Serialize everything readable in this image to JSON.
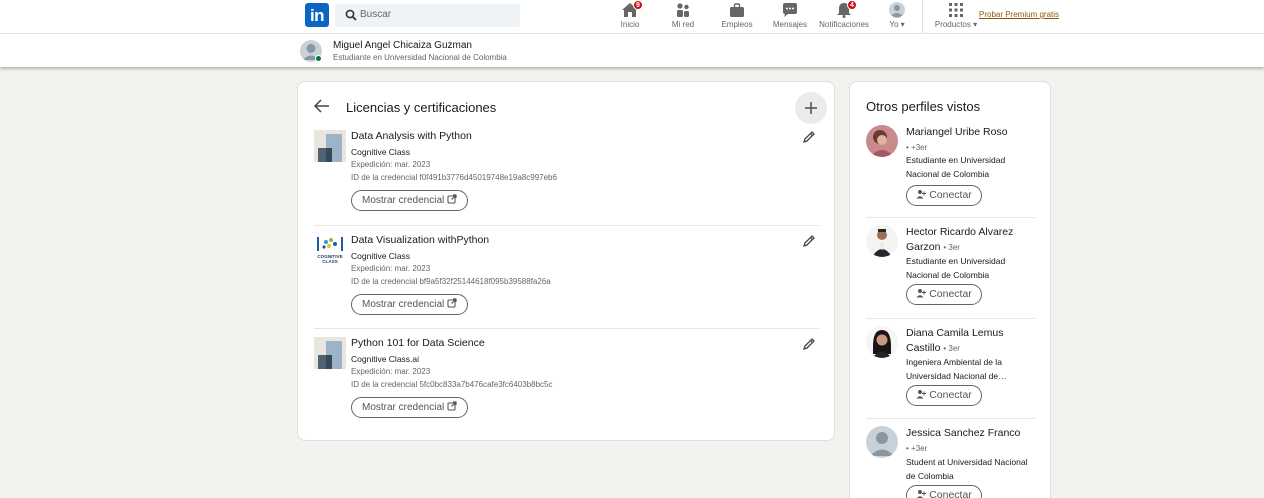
{
  "nav": {
    "logo": "in",
    "search_placeholder": "Buscar",
    "items": [
      {
        "label": "Inicio",
        "icon": "home-icon",
        "badge": "9"
      },
      {
        "label": "Mi red",
        "icon": "network-icon",
        "badge": ""
      },
      {
        "label": "Empleos",
        "icon": "briefcase-icon",
        "badge": ""
      },
      {
        "label": "Mensajes",
        "icon": "message-icon",
        "badge": ""
      },
      {
        "label": "Notificaciones",
        "icon": "bell-icon",
        "badge": "4"
      },
      {
        "label": "Yo",
        "icon": "avatar-icon",
        "badge": ""
      },
      {
        "label": "Productos",
        "icon": "grid-icon",
        "badge": ""
      }
    ],
    "premium_label": "Probar Premium gratis"
  },
  "subheader": {
    "name": "Miguel Angel Chicaiza Guzman",
    "headline": "Estudiante en Universidad Nacional de Colombia"
  },
  "main": {
    "title": "Licencias y certificaciones",
    "certifications": [
      {
        "title": "Data Analysis with Python",
        "issuer": "Cognitive Class",
        "date": "Expedición: mar. 2023",
        "credential_id": "ID de la credencial f0f491b3776d45019748e19a8c997eb6",
        "button_label": "Mostrar credencial",
        "logo": "generic-cert-logo"
      },
      {
        "title": "Data Visualization withPython",
        "issuer": "Cognitive Class",
        "date": "Expedición: mar. 2023",
        "credential_id": "ID de la credencial bf9a5f32f25144618f095b39588fa26a",
        "button_label": "Mostrar credencial",
        "logo": "cognitive-class-logo"
      },
      {
        "title": "Python 101 for Data Science",
        "issuer": "Cognitive Class.ai",
        "date": "Expedición: mar. 2023",
        "credential_id": "ID de la credencial 5fc0bc833a7b476cafe3fc6403b8bc5c",
        "button_label": "Mostrar credencial",
        "logo": "generic-cert-logo"
      }
    ],
    "cognitive_logo_text": "COGNITIVE CLASS"
  },
  "side": {
    "title": "Otros perfiles vistos",
    "people": [
      {
        "name": "Mariangel Uribe Roso",
        "degree": "• +3er",
        "headline": "Estudiante en Universidad Nacional de Colombia",
        "button": "Conectar"
      },
      {
        "name": "Hector Ricardo Alvarez Garzon",
        "degree": "• 3er",
        "headline": "Estudiante en Universidad Nacional de Colombia",
        "button": "Conectar"
      },
      {
        "name": "Diana Camila Lemus Castillo",
        "degree": "• 3er",
        "headline": "Ingeniera Ambiental de la Universidad Nacional de…",
        "button": "Conectar"
      },
      {
        "name": "Jessica Sanchez Franco",
        "degree": "• +3er",
        "headline": "Student at Universidad Nacional de Colombia",
        "button": "Conectar"
      }
    ]
  },
  "colors": {
    "brand": "#0a66c2",
    "background": "#f3f2ef",
    "badge": "#cc1016",
    "premium": "#915907"
  }
}
